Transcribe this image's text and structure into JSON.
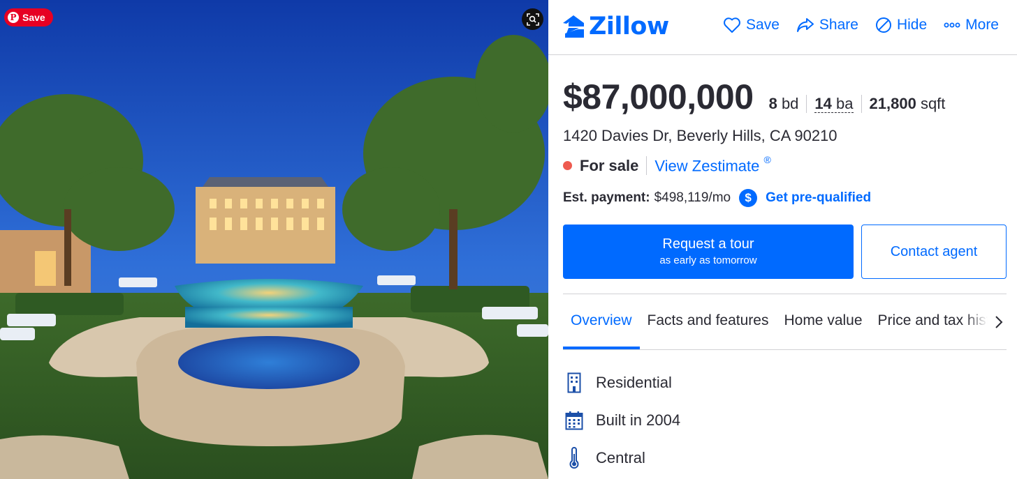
{
  "photo": {
    "pin_save_label": "Save",
    "pin_logo": "P"
  },
  "header": {
    "brand": "Zillow",
    "actions": [
      {
        "label": "Save",
        "icon": "heart-icon"
      },
      {
        "label": "Share",
        "icon": "share-arrow-icon"
      },
      {
        "label": "Hide",
        "icon": "hide-circle-icon"
      },
      {
        "label": "More",
        "icon": "more-dots-icon"
      }
    ]
  },
  "listing": {
    "price": "$87,000,000",
    "beds": "8",
    "beds_unit": "bd",
    "baths": "14",
    "baths_unit": "ba",
    "sqft": "21,800",
    "sqft_unit": "sqft",
    "address": "1420 Davies Dr, Beverly Hills, CA 90210",
    "status": "For sale",
    "zestimate_link": "View Zestimate",
    "zestimate_mark": "®",
    "est_payment_label": "Est. payment:",
    "est_payment_value": "$498,119/mo",
    "prequal_icon_glyph": "$",
    "prequal_label": "Get pre-qualified"
  },
  "cta": {
    "tour_label": "Request a tour",
    "tour_sub": "as early as tomorrow",
    "contact_label": "Contact agent"
  },
  "tabs": [
    {
      "label": "Overview",
      "active": true
    },
    {
      "label": "Facts and features",
      "active": false
    },
    {
      "label": "Home value",
      "active": false
    },
    {
      "label": "Price and tax history",
      "active": false
    }
  ],
  "overview": [
    {
      "icon": "building-icon",
      "text": "Residential"
    },
    {
      "icon": "calendar-icon",
      "text": "Built in 2004"
    },
    {
      "icon": "thermometer-icon",
      "text": "Central"
    }
  ],
  "colors": {
    "brand_blue": "#006aff",
    "status_red": "#ee5a4f",
    "pinterest_red": "#e60023",
    "text_dark": "#2a2a33"
  }
}
